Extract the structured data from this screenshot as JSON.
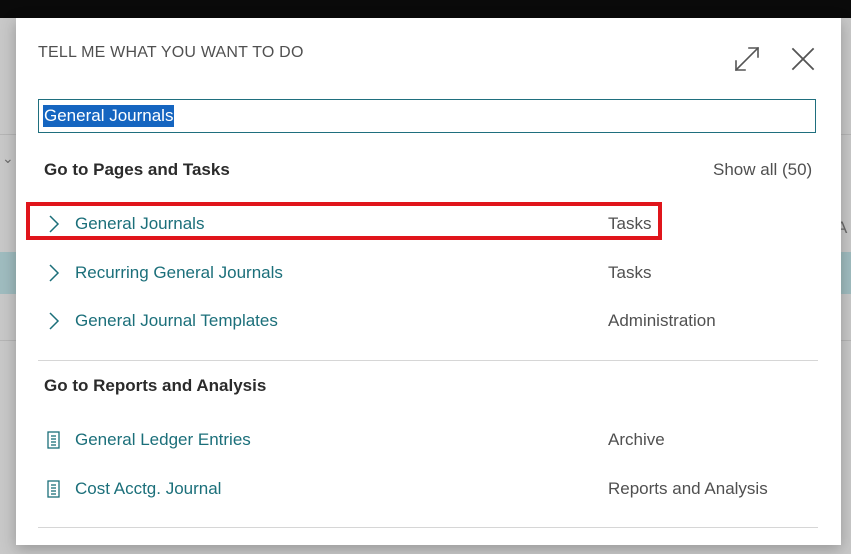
{
  "dialog": {
    "title": "TELL ME WHAT YOU WANT TO DO",
    "expand_icon": "expand-icon",
    "close_icon": "close-icon"
  },
  "search": {
    "value": "General Journals"
  },
  "pages_section": {
    "heading": "Go to Pages and Tasks",
    "show_all": "Show all (50)",
    "items": [
      {
        "name": "General Journals",
        "category": "Tasks",
        "icon": "chevron-right-icon"
      },
      {
        "name": "Recurring General Journals",
        "category": "Tasks",
        "icon": "chevron-right-icon"
      },
      {
        "name": "General Journal Templates",
        "category": "Administration",
        "icon": "chevron-right-icon"
      }
    ]
  },
  "reports_section": {
    "heading": "Go to Reports and Analysis",
    "items": [
      {
        "name": "General Ledger Entries",
        "category": "Archive",
        "icon": "report-icon"
      },
      {
        "name": "Cost Acctg. Journal",
        "category": "Reports and Analysis",
        "icon": "report-icon"
      }
    ]
  },
  "colors": {
    "link": "#1b6f7a",
    "highlight_border": "#e0151b",
    "selection": "#1565c0"
  }
}
